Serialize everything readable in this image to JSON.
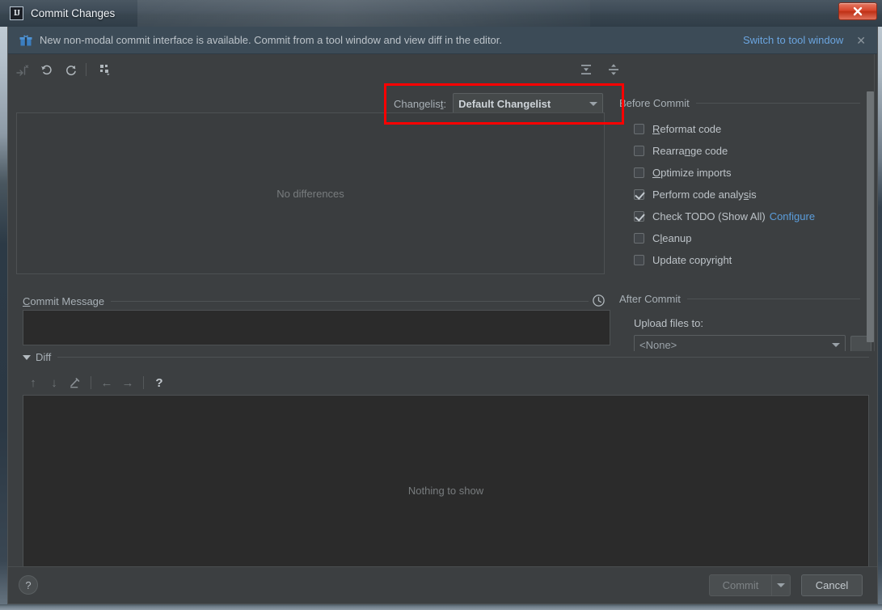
{
  "window": {
    "title": "Commit Changes",
    "app_icon": "intellij-idea-icon",
    "close_label": "✕"
  },
  "notification": {
    "icon": "gift-icon",
    "text": "New non-modal commit interface is available. Commit from a tool window and view diff in the editor.",
    "link": "Switch to tool window",
    "close": "✕"
  },
  "toolbar": {
    "icons": [
      {
        "name": "show-diff-icon",
        "glyph": "⇥",
        "disabled": true
      },
      {
        "name": "rollback-icon",
        "glyph": "↺",
        "disabled": false
      },
      {
        "name": "refresh-icon",
        "glyph": "⟳",
        "disabled": false
      },
      {
        "name": "group-by-icon",
        "glyph": "∷",
        "disabled": false
      }
    ],
    "expand_all": "expand-all-icon",
    "collapse_all": "collapse-all-icon"
  },
  "changelist": {
    "label_pre": "Changelis",
    "label_accel": "t",
    "label_post": ":",
    "value": "Default Changelist",
    "highlighted": true,
    "highlight_color": "#fe0000"
  },
  "files_pane": {
    "empty_text": "No differences"
  },
  "commit_message": {
    "label_accel": "C",
    "label_rest": "ommit Message",
    "value": "",
    "history_icon": "clock-icon"
  },
  "diff_section": {
    "label": "Diff",
    "expanded": true,
    "toolbar": [
      {
        "name": "previous-difference-icon",
        "glyph": "↑",
        "disabled": true
      },
      {
        "name": "next-difference-icon",
        "glyph": "↓",
        "disabled": true
      },
      {
        "name": "edit-source-icon",
        "glyph": "╱",
        "disabled": true
      },
      {
        "name": "separator-1",
        "glyph": "|",
        "disabled": true
      },
      {
        "name": "arrow-left-icon",
        "glyph": "←",
        "disabled": true
      },
      {
        "name": "arrow-right-icon",
        "glyph": "→",
        "disabled": true
      },
      {
        "name": "separator-2",
        "glyph": "|",
        "disabled": true
      },
      {
        "name": "help-diff-icon",
        "glyph": "?",
        "disabled": false
      }
    ],
    "empty_text": "Nothing to show"
  },
  "before_commit": {
    "title": "Before Commit",
    "options": [
      {
        "label_pre": "",
        "accel": "R",
        "label_post": "eformat code",
        "checked": false,
        "name": "reformat-code"
      },
      {
        "label_pre": "Rearra",
        "accel": "n",
        "label_post": "ge code",
        "checked": false,
        "name": "rearrange-code"
      },
      {
        "label_pre": "",
        "accel": "O",
        "label_post": "ptimize imports",
        "checked": false,
        "name": "optimize-imports"
      },
      {
        "label_pre": "Perform code analy",
        "accel": "s",
        "label_post": "is",
        "checked": true,
        "name": "perform-code-analysis"
      },
      {
        "label_pre": "Check TODO (Show All)",
        "accel": "",
        "label_post": "",
        "checked": true,
        "name": "check-todo",
        "link": "Configure"
      },
      {
        "label_pre": "C",
        "accel": "l",
        "label_post": "eanup",
        "checked": false,
        "name": "cleanup"
      },
      {
        "label_pre": "Update copyright",
        "accel": "",
        "label_post": "",
        "checked": false,
        "name": "update-copyright"
      }
    ]
  },
  "after_commit": {
    "title": "After Commit",
    "upload_label": "Upload files to:",
    "upload_value": "<None>"
  },
  "footer": {
    "help": "?",
    "commit_label": "Commit",
    "commit_disabled": true,
    "commit_split": "▾",
    "cancel_label": "Cancel"
  }
}
